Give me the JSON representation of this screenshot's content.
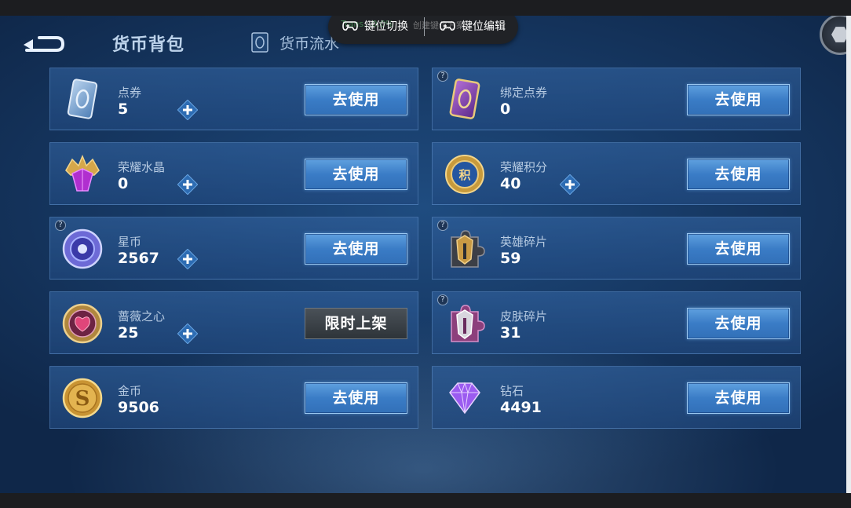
{
  "header": {
    "title": "货币背包",
    "flow_tab": "货币流水"
  },
  "overlay": {
    "ghost_left": "Trans...0.0%",
    "ghost_right": "创建键位方案",
    "switch_label": "键位切换",
    "edit_label": "键位编辑"
  },
  "currencies": [
    {
      "name": "点券",
      "value": "5",
      "button": "去使用",
      "plus": true,
      "help": false,
      "icon": "voucher-card-icon"
    },
    {
      "name": "绑定点券",
      "value": "0",
      "button": "去使用",
      "plus": false,
      "help": true,
      "icon": "bound-voucher-card-icon"
    },
    {
      "name": "荣耀水晶",
      "value": "0",
      "button": "去使用",
      "plus": true,
      "help": false,
      "icon": "glory-crystal-icon"
    },
    {
      "name": "荣耀积分",
      "value": "40",
      "button": "去使用",
      "plus": true,
      "help": false,
      "icon": "glory-points-icon"
    },
    {
      "name": "星币",
      "value": "2567",
      "button": "去使用",
      "plus": true,
      "help": true,
      "icon": "star-coin-icon"
    },
    {
      "name": "英雄碎片",
      "value": "59",
      "button": "去使用",
      "plus": false,
      "help": true,
      "icon": "hero-fragment-icon"
    },
    {
      "name": "蔷薇之心",
      "value": "25",
      "button": "限时上架",
      "plus": true,
      "help": false,
      "icon": "rose-heart-icon"
    },
    {
      "name": "皮肤碎片",
      "value": "31",
      "button": "去使用",
      "plus": false,
      "help": true,
      "icon": "skin-fragment-icon"
    },
    {
      "name": "金币",
      "value": "9506",
      "button": "去使用",
      "plus": false,
      "help": false,
      "icon": "gold-coin-icon"
    },
    {
      "name": "钻石",
      "value": "4491",
      "button": "去使用",
      "plus": false,
      "help": false,
      "icon": "diamond-icon"
    }
  ],
  "colors": {
    "background": "#173a66",
    "button": "#3a7cc6",
    "limited_button": "#2e3439",
    "text_label": "#b7cbe2"
  }
}
